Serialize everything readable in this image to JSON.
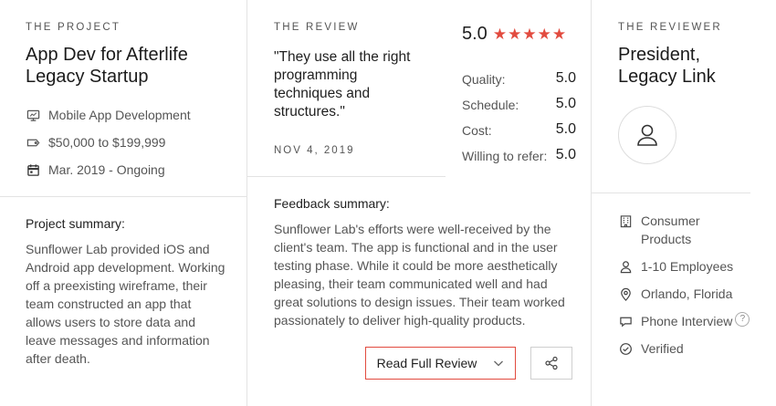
{
  "project": {
    "eyebrow": "THE PROJECT",
    "title_line1": "App Dev for Afterlife",
    "title_line2": "Legacy Startup",
    "service": "Mobile App Development",
    "budget": "$50,000 to $199,999",
    "timeline": "Mar. 2019 - Ongoing",
    "summary_label": "Project summary:",
    "summary_text": "Sunflower Lab provided iOS and Android app development. Working off a preexisting wireframe, their team constructed an app that allows users to store data and leave messages and information after death."
  },
  "review": {
    "eyebrow": "THE REVIEW",
    "quote_lines": [
      "\"They use all the right",
      "programming",
      "techniques and",
      "structures.\""
    ],
    "date": "NOV 4, 2019",
    "overall": "5.0",
    "stars": [
      "★",
      "★",
      "★",
      "★",
      "★"
    ],
    "star_color": "#e24b3f",
    "scores": [
      {
        "label": "Quality:",
        "value": "5.0"
      },
      {
        "label": "Schedule:",
        "value": "5.0"
      },
      {
        "label": "Cost:",
        "value": "5.0"
      },
      {
        "label": "Willing to refer:",
        "value": "5.0"
      }
    ],
    "feedback_label": "Feedback summary:",
    "feedback_text": "Sunflower Lab's efforts were well-received by the client's team. The app is functional and in the user testing phase. While it could be more aesthetically pleasing, their team communicated well and had great solutions to design issues. Their team worked passionately to deliver high-quality products.",
    "read_button": "Read Full Review",
    "share_icon": "share-icon"
  },
  "reviewer": {
    "eyebrow": "THE REVIEWER",
    "title_line1": "President,",
    "title_line2": "Legacy Link",
    "industry_line1": "Consumer",
    "industry_line2": "Products",
    "size": "1-10 Employees",
    "location": "Orlando, Florida",
    "interview": "Phone Interview",
    "help": "?",
    "verified": "Verified"
  }
}
